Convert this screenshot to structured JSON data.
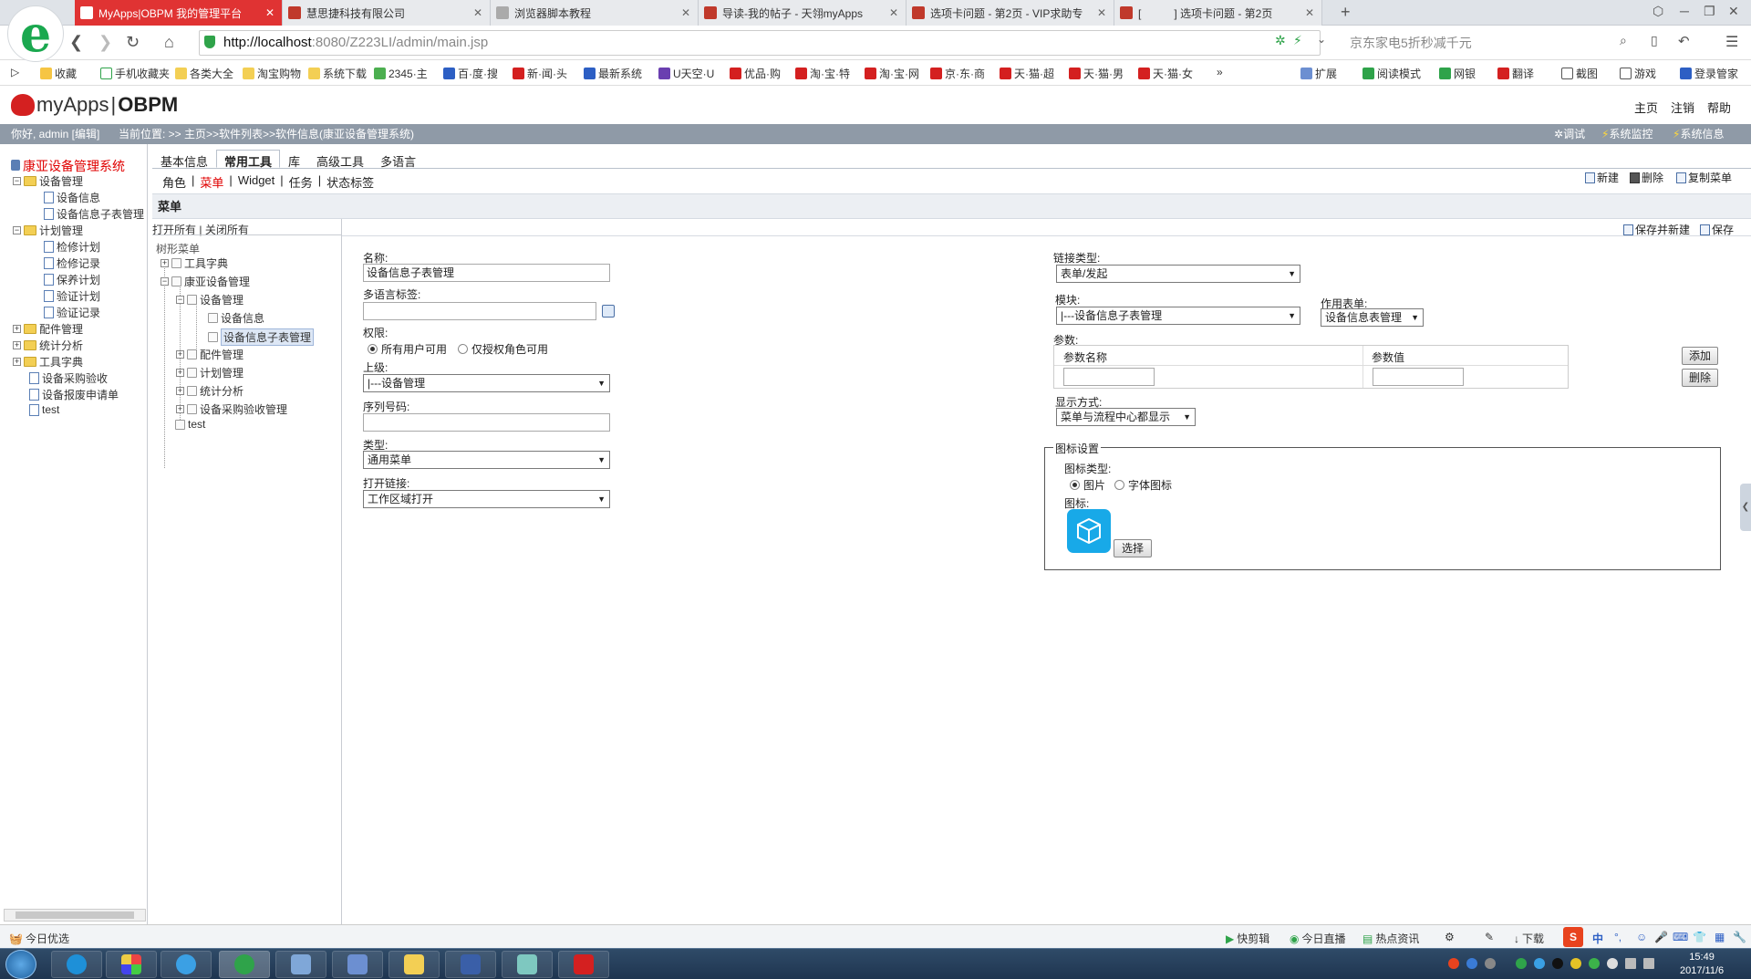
{
  "browser": {
    "tabs": [
      {
        "title": "MyApps|OBPM 我的管理平台",
        "active": true
      },
      {
        "title": "慧思捷科技有限公司",
        "active": false
      },
      {
        "title": "浏览器脚本教程",
        "active": false
      },
      {
        "title": "导读-我的帖子 - 天翎myApps",
        "active": false
      },
      {
        "title": "选项卡问题 - 第2页 - VIP求助专",
        "active": false
      },
      {
        "title": "[　　　] 选项卡问题 - 第2页",
        "active": false
      }
    ],
    "url_host": "http://localhost",
    "url_path": ":8080/Z223LI/admin/main.jsp",
    "search_placeholder": "京东家电5折秒减千元",
    "bookmarks": [
      "收藏",
      "手机收藏夹",
      "各类大全",
      "淘宝购物",
      "系统下载",
      "2345·主",
      "百·度·搜",
      "新·闻·头",
      "最新系统",
      "U天空·U",
      "优品·购",
      "淘·宝·特",
      "淘·宝·网",
      "京·东·商",
      "天·猫·超",
      "天·猫·男",
      "天·猫·女",
      "»"
    ],
    "bookmarks_right": [
      "扩展",
      "阅读模式",
      "网银",
      "翻译",
      "截图",
      "游戏",
      "登录管家"
    ]
  },
  "app": {
    "logo_text_light": "myApps",
    "logo_text_bold": "OBPM",
    "header_links": [
      "主页",
      "注销",
      "帮助"
    ],
    "greeting": "你好, admin [编辑]",
    "location": "当前位置: >> 主页>>软件列表>>软件信息(康亚设备管理系统)",
    "info_actions": [
      "调试",
      "系统监控",
      "系统信息"
    ]
  },
  "left_tree": {
    "title": "康亚设备管理系统",
    "nodes": [
      {
        "label": "设备管理",
        "type": "folder",
        "expander": "−"
      },
      {
        "label": "设备信息",
        "type": "doc"
      },
      {
        "label": "设备信息子表管理",
        "type": "doc"
      },
      {
        "label": "计划管理",
        "type": "folder",
        "expander": "−"
      },
      {
        "label": "检修计划",
        "type": "doc"
      },
      {
        "label": "检修记录",
        "type": "doc"
      },
      {
        "label": "保养计划",
        "type": "doc"
      },
      {
        "label": "验证计划",
        "type": "doc"
      },
      {
        "label": "验证记录",
        "type": "doc"
      },
      {
        "label": "配件管理",
        "type": "folder",
        "expander": "+"
      },
      {
        "label": "统计分析",
        "type": "folder",
        "expander": "+"
      },
      {
        "label": "工具字典",
        "type": "folder",
        "expander": "+"
      },
      {
        "label": "设备采购验收",
        "type": "doc"
      },
      {
        "label": "设备报废申请单",
        "type": "doc"
      },
      {
        "label": "test",
        "type": "doc"
      }
    ]
  },
  "main": {
    "tabs": [
      "基本信息",
      "常用工具",
      "库",
      "高级工具",
      "多语言"
    ],
    "selected_tab": "常用工具",
    "subtabs": [
      "角色",
      "菜单",
      "Widget",
      "任务",
      "状态标签"
    ],
    "subtab_sep": "|",
    "selected_subtab": "菜单",
    "toolbar": [
      "新建",
      "删除",
      "复制菜单"
    ],
    "section_title": "菜单",
    "save_actions": [
      "保存并新建",
      "保存"
    ]
  },
  "menu_tree": {
    "expand_all": "打开所有",
    "collapse_all": "关闭所有",
    "label": "树形菜单",
    "nodes": [
      {
        "label": "工具字典",
        "expander": "+"
      },
      {
        "label": "康亚设备管理",
        "expander": "−"
      },
      {
        "label": "设备管理",
        "expander": "−"
      },
      {
        "label": "设备信息",
        "expander": ""
      },
      {
        "label": "设备信息子表管理",
        "expander": "",
        "selected": true
      },
      {
        "label": "配件管理",
        "expander": "+"
      },
      {
        "label": "计划管理",
        "expander": "+"
      },
      {
        "label": "统计分析",
        "expander": "+"
      },
      {
        "label": "设备采购验收管理",
        "expander": "+"
      },
      {
        "label": "test",
        "expander": ""
      }
    ]
  },
  "form": {
    "name_label": "名称:",
    "name_value": "设备信息子表管理",
    "i18n_label": "多语言标签:",
    "i18n_value": "",
    "perm_label": "权限:",
    "perm_options": [
      "所有用户可用",
      "仅授权角色可用"
    ],
    "perm_selected": 0,
    "parent_label": "上级:",
    "parent_value": "|---设备管理",
    "order_label": "序列号码:",
    "order_value": "",
    "type_label": "类型:",
    "type_value": "通用菜单",
    "open_label": "打开链接:",
    "open_value": "工作区域打开",
    "link_type_label": "链接类型:",
    "link_type_value": "表单/发起",
    "module_label": "模块:",
    "module_value": "|---设备信息子表管理",
    "form_label": "作用表单:",
    "form_value": "设备信息表管理",
    "params_label": "参数:",
    "param_name_col": "参数名称",
    "param_value_col": "参数值",
    "add_btn": "添加",
    "del_btn": "删除",
    "display_label": "显示方式:",
    "display_value": "菜单与流程中心都显示",
    "icon_group_label": "图标设置",
    "icon_type_label": "图标类型:",
    "icon_type_options": [
      "图片",
      "字体图标"
    ],
    "icon_type_selected": 0,
    "icon_label": "图标:",
    "choose_btn": "选择"
  },
  "statusbar": {
    "left": "今日优选",
    "right": [
      "快剪辑",
      "今日直播",
      "热点资讯",
      "下载"
    ]
  },
  "taskbar": {
    "time": "15:49",
    "date": "2017/11/6"
  },
  "colors": {
    "active_tab": "#e03333",
    "info_bar": "#8f9aa7",
    "tree_title": "#e00000",
    "icon_tile": "#18a9e8"
  }
}
